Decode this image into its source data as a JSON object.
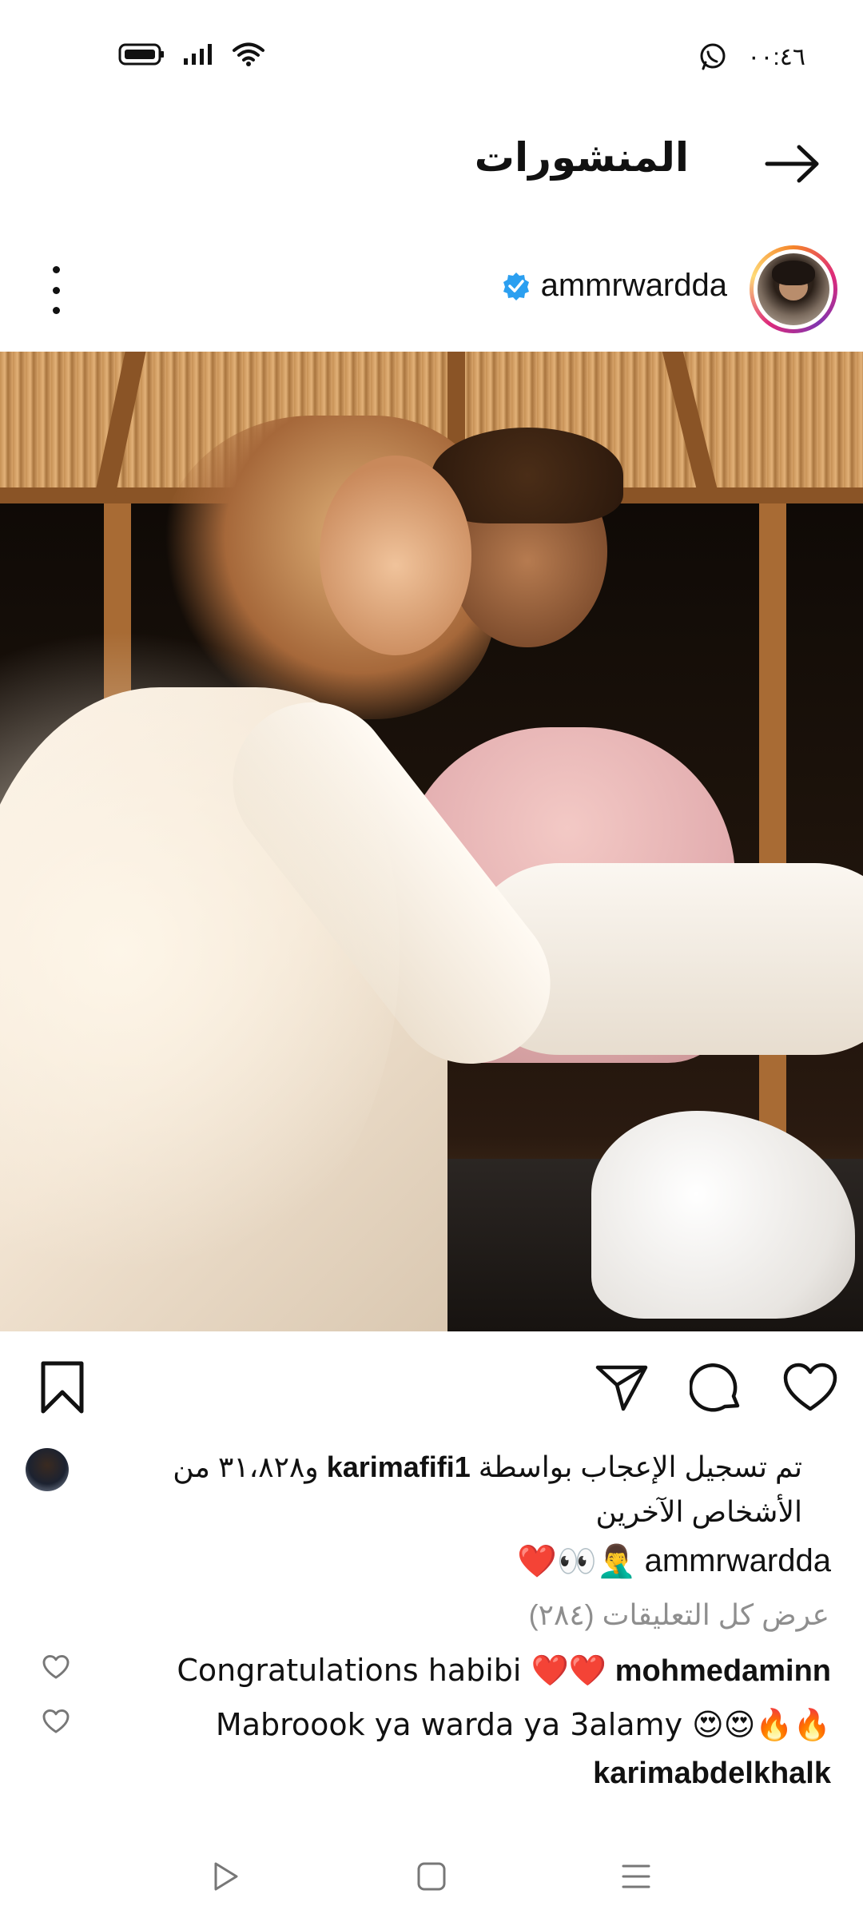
{
  "status_bar": {
    "time": "٠٠:٤٦",
    "icons": [
      "battery-icon",
      "signal-icon",
      "wifi-icon",
      "whatsapp-icon"
    ]
  },
  "header": {
    "title": "المنشورات",
    "back_icon": "arrow-right-icon"
  },
  "post": {
    "username": "ammrwardda",
    "verified_icon": "verified-badge-icon",
    "more_icon": "more-vertical-icon",
    "photo_alt": "couple-photo"
  },
  "actions": {
    "like_icon": "heart-icon",
    "comment_icon": "comment-icon",
    "share_icon": "send-icon",
    "save_icon": "bookmark-icon"
  },
  "likes": {
    "prefix": "تم تسجيل الإعجاب بواسطة ",
    "user": "karimafifi1",
    "suffix": " و٣١،٨٢٨ من الأشخاص الآخرين"
  },
  "caption": {
    "user": "ammrwardda",
    "text": "❤️👀🤦‍♂️"
  },
  "view_all_comments": "عرض كل التعليقات (٢٨٤)",
  "comments": [
    {
      "user": "mohmedaminn",
      "text": "Congratulations habibi ❤️❤️"
    },
    {
      "user": "karimabdelkhalk",
      "text": "Mabroook ya warda ya 3alamy 😍😍🔥🔥"
    }
  ],
  "nav": {
    "back_icon": "triangle-back-icon",
    "home_icon": "square-home-icon",
    "menu_icon": "menu-lines-icon"
  }
}
